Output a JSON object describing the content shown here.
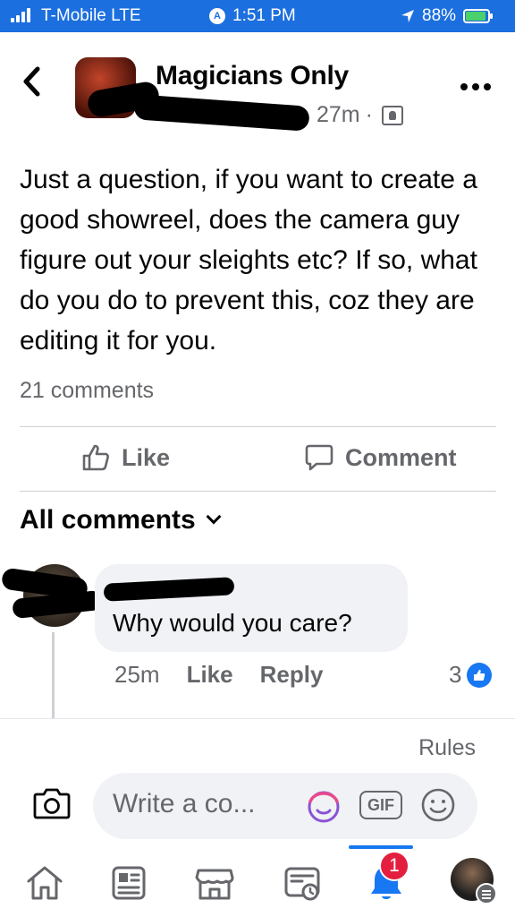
{
  "status_bar": {
    "carrier": "T-Mobile  LTE",
    "time": "1:51 PM",
    "battery": "88%"
  },
  "header": {
    "group_name": "Magicians Only",
    "time_ago": "27m",
    "separator": "·"
  },
  "post": {
    "text": "Just a question, if you want to create a good showreel, does the camera guy figure out your sleights etc? If so, what do you do to prevent this, coz they are editing it for you.",
    "comment_count": "21 comments",
    "like_label": "Like",
    "comment_label": "Comment"
  },
  "comments_section": {
    "title": "All comments"
  },
  "comment": {
    "text": "Why would you care?",
    "time_ago": "25m",
    "like_label": "Like",
    "reply_label": "Reply",
    "reaction_count": "3"
  },
  "composer": {
    "rules_label": "Rules",
    "placeholder": "Write a co...",
    "gif_label": "GIF"
  },
  "bottom_nav": {
    "notification_count": "1"
  },
  "colors": {
    "status_bar": "#1c6fde",
    "accent": "#1877f2",
    "badge": "#e41e3f",
    "muted_text": "#65676b"
  }
}
